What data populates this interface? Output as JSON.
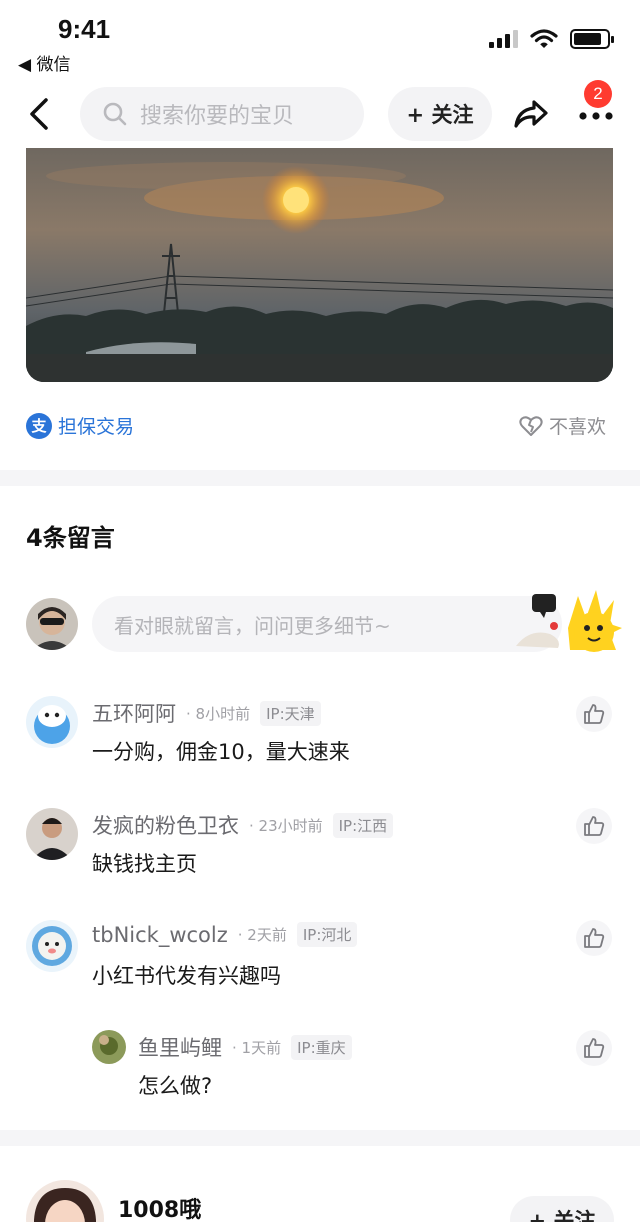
{
  "status_bar": {
    "time": "9:41",
    "back_app": "◀ 微信",
    "signal_bars": 4,
    "signal_active": 3,
    "battery_level": 0.85
  },
  "nav": {
    "search_placeholder": "搜索你要的宝贝",
    "follow_label": "+ 关注",
    "badge_count": "2"
  },
  "trade": {
    "label": "担保交易",
    "icon_text": "支",
    "dislike_label": "不喜欢"
  },
  "comments": {
    "title": "4条留言",
    "input_placeholder": "看对眼就留言，问问更多细节~",
    "items": [
      {
        "name": "五环阿阿",
        "time": "· 8小时前",
        "ip": "IP:天津",
        "text": "一分购，佣金10，量大速来",
        "avatar_color": "#4da3e8"
      },
      {
        "name": "发疯的粉色卫衣",
        "time": "· 23小时前",
        "ip": "IP:江西",
        "text": "缺钱找主页",
        "avatar_color": "#3b2f2a"
      },
      {
        "name": "tbNick_wcolz",
        "time": "· 2天前",
        "ip": "IP:河北",
        "text": "小红书代发有兴趣吗",
        "avatar_color": "#5fa8e0"
      }
    ],
    "reply": {
      "name": "鱼里屿鲤",
      "time": "· 1天前",
      "ip": "IP:重庆",
      "text": "怎么做?",
      "avatar_color": "#6a7a3c"
    }
  },
  "seller": {
    "name": "1008哦",
    "follow_label": "+ 关注"
  },
  "colors": {
    "accent_blue": "#2a74d8",
    "badge_red": "#ff3b30",
    "bg_gray": "#f3f3f5"
  }
}
